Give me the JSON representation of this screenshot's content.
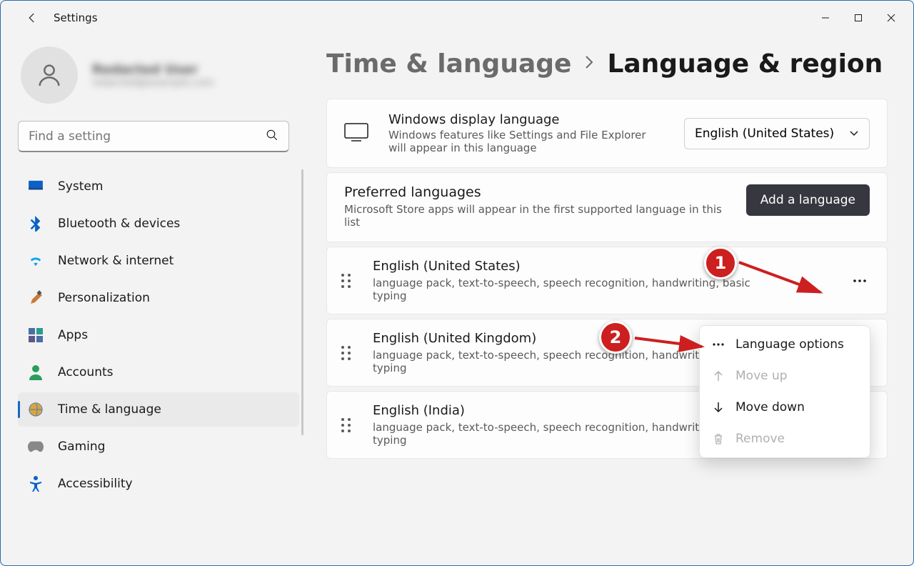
{
  "window": {
    "app_title": "Settings"
  },
  "profile": {
    "name": "Redacted User",
    "email": "redacted@example.com"
  },
  "search": {
    "placeholder": "Find a setting"
  },
  "nav": {
    "items": [
      {
        "label": "System"
      },
      {
        "label": "Bluetooth & devices"
      },
      {
        "label": "Network & internet"
      },
      {
        "label": "Personalization"
      },
      {
        "label": "Apps"
      },
      {
        "label": "Accounts"
      },
      {
        "label": "Time & language"
      },
      {
        "label": "Gaming"
      },
      {
        "label": "Accessibility"
      }
    ]
  },
  "breadcrumb": {
    "parent": "Time & language",
    "current": "Language & region"
  },
  "display_language": {
    "title": "Windows display language",
    "desc": "Windows features like Settings and File Explorer will appear in this language",
    "selected": "English (United States)"
  },
  "preferred": {
    "title": "Preferred languages",
    "desc": "Microsoft Store apps will appear in the first supported language in this list",
    "add_label": "Add a language"
  },
  "languages": [
    {
      "name": "English (United States)",
      "features": "language pack, text-to-speech, speech recognition, handwriting, basic typing"
    },
    {
      "name": "English (United Kingdom)",
      "features": "language pack, text-to-speech, speech recognition, handwriting, basic typing"
    },
    {
      "name": "English (India)",
      "features": "language pack, text-to-speech, speech recognition, handwriting, basic typing"
    }
  ],
  "context_menu": {
    "language_options": "Language options",
    "move_up": "Move up",
    "move_down": "Move down",
    "remove": "Remove"
  },
  "annotations": {
    "one": "1",
    "two": "2"
  }
}
